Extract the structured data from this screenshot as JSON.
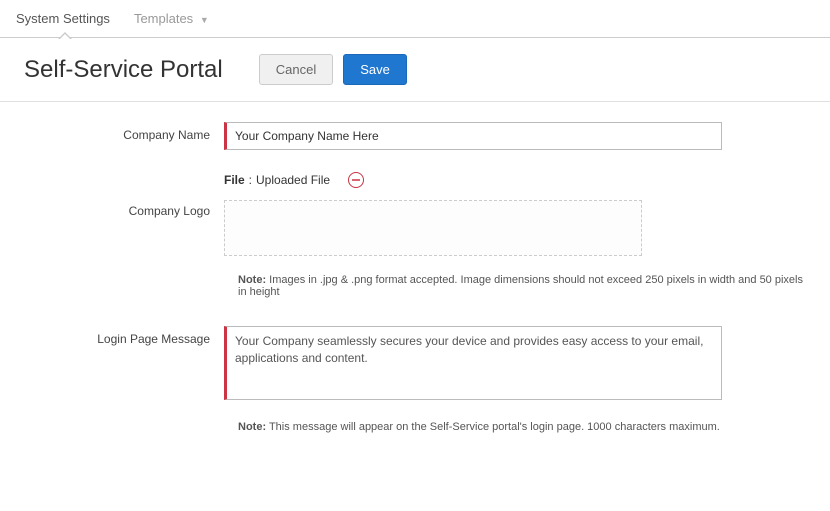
{
  "tabs": {
    "system_settings": "System Settings",
    "templates": "Templates"
  },
  "header": {
    "title": "Self-Service Portal",
    "cancel": "Cancel",
    "save": "Save"
  },
  "form": {
    "company_name_label": "Company Name",
    "company_name_value": "Your Company Name Here",
    "company_logo_label": "Company Logo",
    "file_label": "File",
    "file_separator": ":",
    "file_value": "Uploaded File",
    "logo_note_prefix": "Note:",
    "logo_note_text": " Images in .jpg & .png format accepted. Image dimensions should not exceed 250 pixels in width and 50 pixels in height",
    "login_msg_label": "Login Page Message",
    "login_msg_value": "Your Company seamlessly secures your device and provides easy access to your email, applications and content.",
    "login_msg_note_prefix": "Note:",
    "login_msg_note_text": " This message will appear on the Self-Service portal's login page. 1000 characters maximum."
  }
}
